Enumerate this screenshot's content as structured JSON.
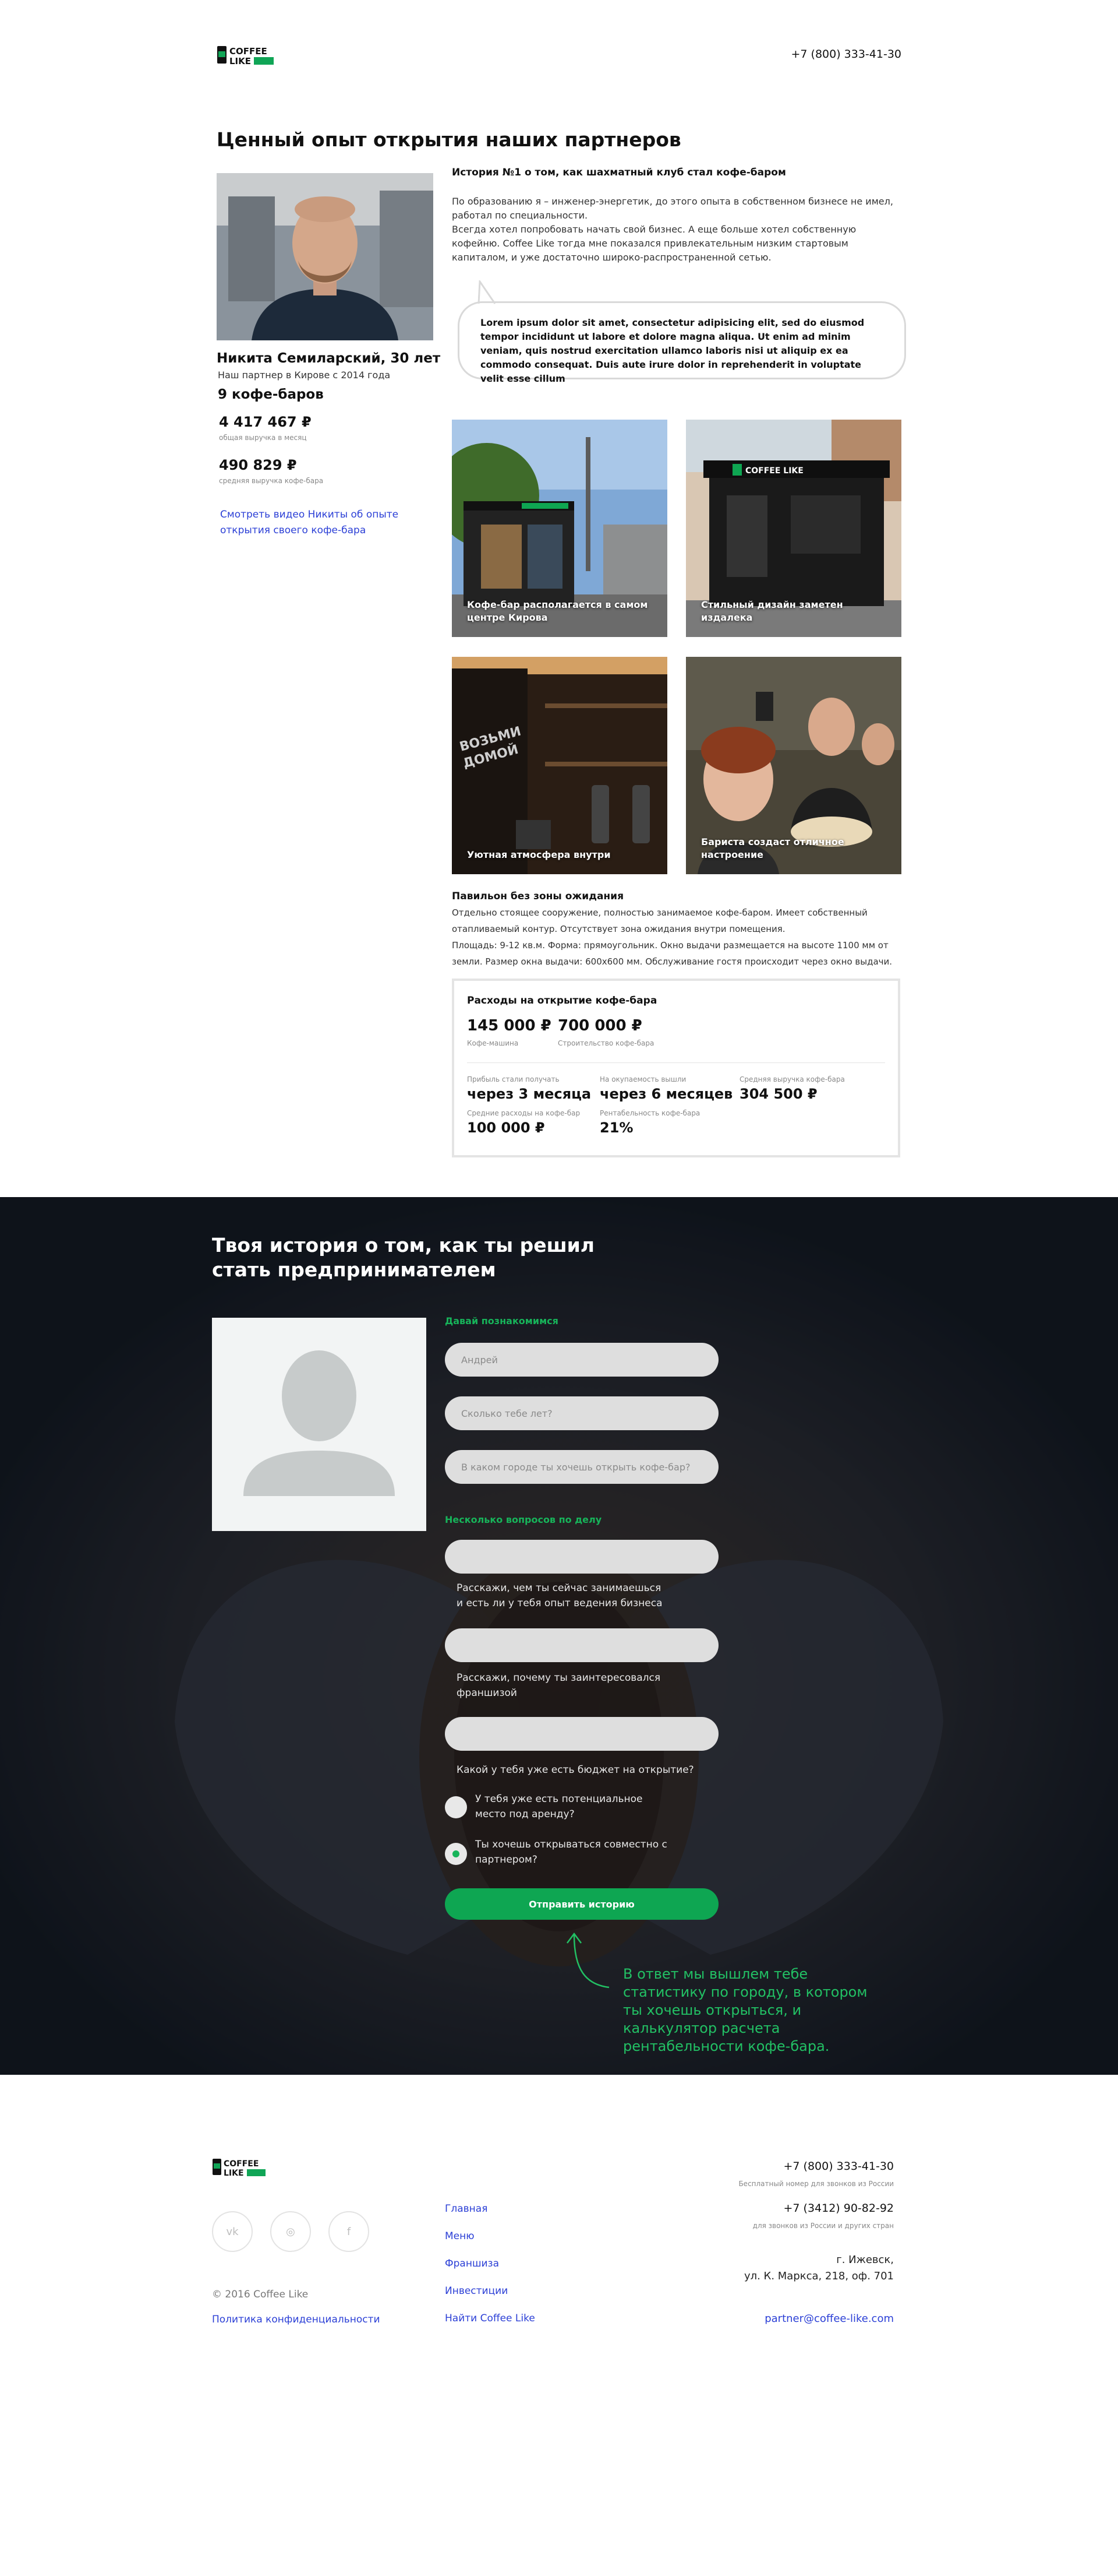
{
  "header": {
    "logo_line1": "COFFEE",
    "logo_line2": "LIKE",
    "phone": "+7 (800) 333-41-30"
  },
  "page_title": "Ценный опыт открытия наших партнеров",
  "partner": {
    "name": "Никита Семиларский, 30 лет",
    "since": "Наш партнер в Кирове с 2014 года",
    "bars": "9 кофе-баров",
    "revenue": "4 417 467 ₽",
    "revenue_caption": "общая выручка в месяц",
    "avg_revenue": "490 829 ₽",
    "avg_caption": "средняя выручка кофе-бара",
    "video_link": "Смотреть видео Никиты об опыте открытия своего кофе-бара"
  },
  "story": {
    "title": "История №1 о том, как шахматный клуб стал кофе-баром",
    "paragraph1": "По образованию я – инженер-энергетик, до этого опыта в собственном бизнесе не имел, работал по специальности.",
    "paragraph2": "Всегда хотел попробовать начать свой бизнес. А еще больше хотел собственную кофейню. Coffee Like тогда мне показался привлекательным низким стартовым капиталом, и уже достаточно широко-распространенной сетью.",
    "quote": "Lorem ipsum dolor sit amet, consectetur adipisicing elit, sed do eiusmod tempor incididunt ut labore et dolore magna aliqua. Ut enim ad minim veniam, quis nostrud exercitation ullamco laboris nisi ut aliquip ex ea commodo consequat. Duis aute irure dolor in reprehenderit in voluptate velit esse cillum"
  },
  "photos": [
    {
      "caption": "Кофе-бар располагается в самом центре Кирова"
    },
    {
      "caption": "Стильный дизайн заметен издалека"
    },
    {
      "caption": "Уютная атмосфера внутри"
    },
    {
      "caption": "Бариста создаст отличное настроение"
    }
  ],
  "photo_signs": {
    "sign_logo": "COFFEE LIKE",
    "wall_text_1": "ВОЗЬМИ",
    "wall_text_2": "ДОМОЙ"
  },
  "pavilion": {
    "title": "Павильон без зоны ожидания",
    "line1": "Отдельно стоящее сооружение, полностью занимаемое кофе-баром. Имеет собственный отапливаемый контур. Отсутствует зона ожидания внутри помещения.",
    "line2": "Площадь: 9-12 кв.м. Форма: прямоугольник. Окно выдачи размещается на высоте 1100 мм от земли. Размер окна выдачи: 600х600 мм. Обслуживание гостя происходит через окно выдачи."
  },
  "expenses": {
    "title": "Расходы на открытие кофе-бара",
    "machine_value": "145 000 ₽",
    "machine_label": "Кофе-машина",
    "build_value": "700 000 ₽",
    "build_label": "Строительство кофе-бара",
    "profit_label": "Прибыль стали получать",
    "profit_value": "через 3 месяца",
    "payback_label": "На окупаемость вышли",
    "payback_value": "через 6 месяцев",
    "avgrev_label": "Средняя выручка кофе-бара",
    "avgrev_value": "304 500 ₽",
    "avgexp_label": "Средние расходы на кофе-бар",
    "avgexp_value": "100 000 ₽",
    "rent_label": "Рентабельность кофе-бара",
    "rent_value": "21%"
  },
  "form": {
    "title": "Твоя история о том, как ты решил стать предпринимателем",
    "section1": "Давай познакомимся",
    "name_placeholder": "Андрей",
    "age_placeholder": "Сколько тебе лет?",
    "city_placeholder": "В каком городе ты хочешь открыть кофе-бар?",
    "section2": "Несколько вопросов по делу",
    "q1": "Расскажи, чем ты сейчас занимаешься и есть ли у тебя опыт ведения бизнеса",
    "q2": "Расскажи, почему ты заинтересовался франшизой",
    "q3": "Какой у тебя уже есть бюджет на открытие?",
    "radio1": "У тебя уже есть потенциальное место под аренду?",
    "radio2": "Ты хочешь открываться совместно с партнером?",
    "submit": "Отправить историю",
    "promo": "В ответ мы вышлем тебе статистику по городу, в котором ты хочешь открыться, и калькулятор расчета рентабельности кофе-бара."
  },
  "footer": {
    "social": [
      "vk",
      "◎",
      "f"
    ],
    "copyright": "© 2016 Coffee Like",
    "privacy": "Политика конфиденциальности",
    "nav": [
      "Главная",
      "Меню",
      "Франшиза",
      "Инвестиции",
      "Найти Coffee Like"
    ],
    "phone1": "+7 (800) 333-41-30",
    "phone1_note": "Бесплатный номер для звонков из России",
    "phone2": "+7 (3412) 90-82-92",
    "phone2_note": "для звонков из России и других стран",
    "address1": "г. Ижевск,",
    "address2": "ул. К. Маркса, 218, оф. 701",
    "email": "partner@coffee-like.com"
  },
  "colors": {
    "accent_green": "#0ea652",
    "link_blue": "#2b3fd6",
    "dark_bg": "#141a22"
  }
}
